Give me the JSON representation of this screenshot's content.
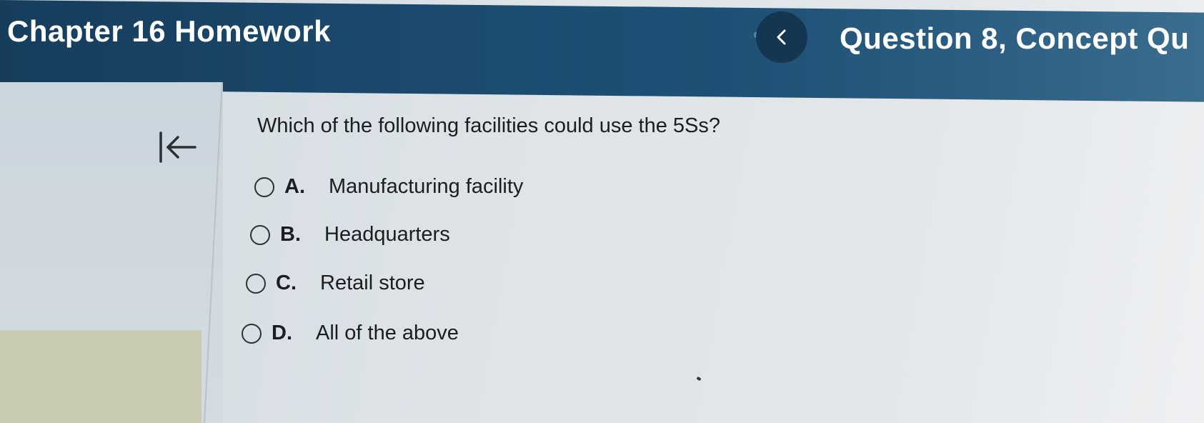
{
  "header": {
    "title": "Chapter 16 Homework",
    "prev_icon": "chevron-left-icon",
    "question_title": "Question 8, Concept Qu"
  },
  "sidebar": {
    "collapse_icon": "collapse-left-arrow-icon"
  },
  "question": {
    "prompt": "Which of the following facilities could use the 5Ss?",
    "options": [
      {
        "letter": "A.",
        "text": "Manufacturing facility",
        "selected": false
      },
      {
        "letter": "B.",
        "text": "Headquarters",
        "selected": false
      },
      {
        "letter": "C.",
        "text": "Retail store",
        "selected": false
      },
      {
        "letter": "D.",
        "text": "All of the above",
        "selected": false
      }
    ]
  },
  "colors": {
    "header_bg": "#1b4a6e",
    "header_text": "#ffffff",
    "body_text": "#1a1d21"
  }
}
